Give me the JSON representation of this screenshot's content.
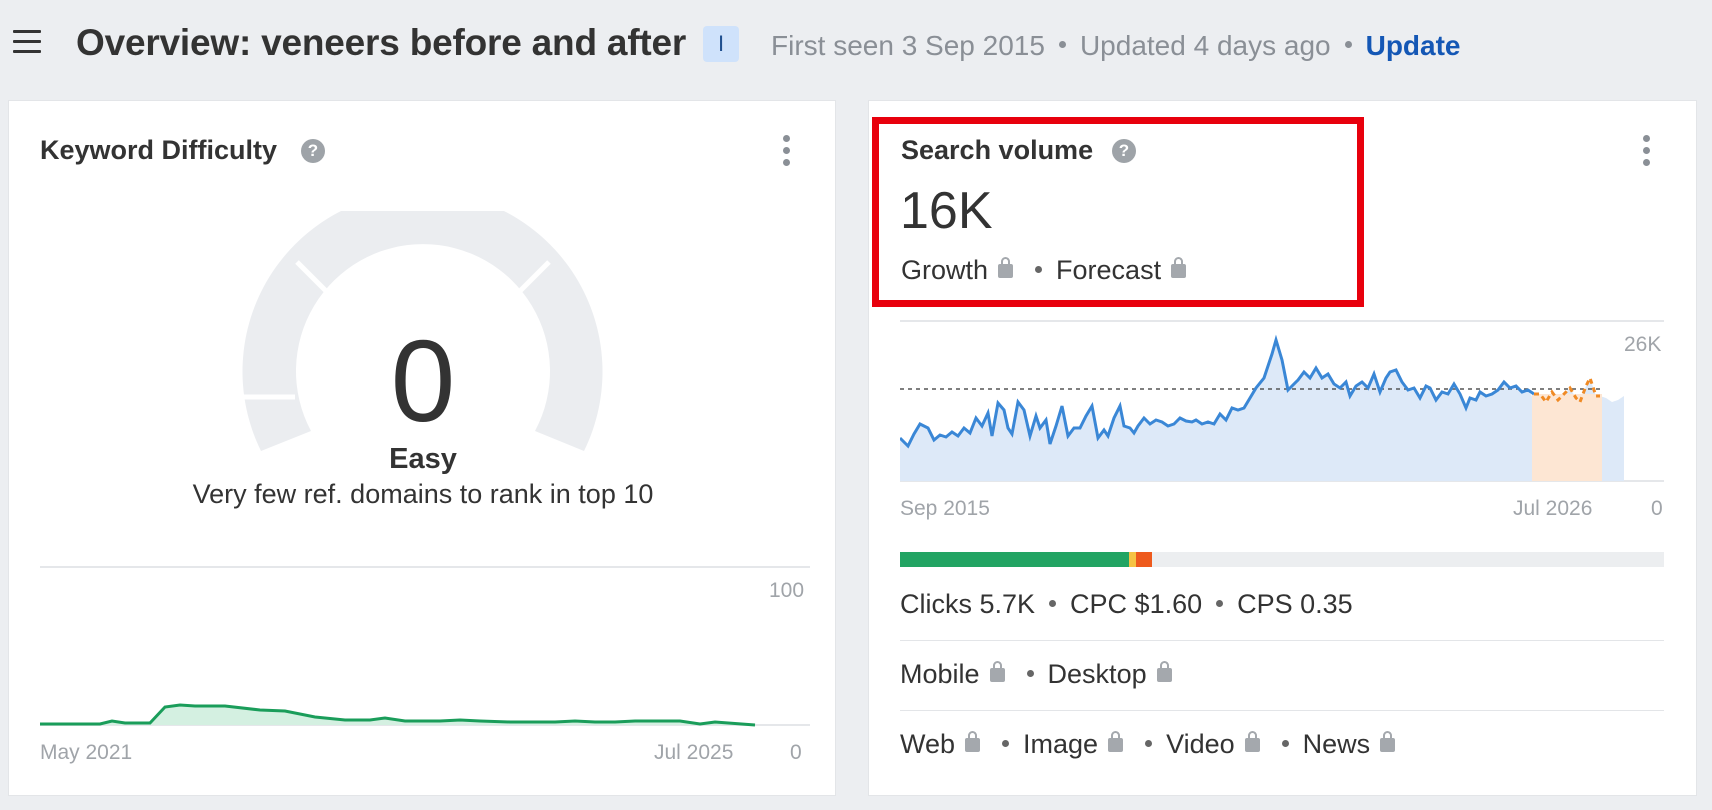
{
  "header": {
    "title": "Overview: veneers before and after",
    "badge": "I",
    "first_seen": "First seen 3 Sep 2015",
    "updated": "Updated 4 days ago",
    "update_link": "Update"
  },
  "kd": {
    "title": "Keyword Difficulty",
    "help": "?",
    "value": "0",
    "label": "Easy",
    "description": "Very few ref. domains to rank in top 10",
    "chart": {
      "y_max_label": "100",
      "y_min_label": "0",
      "x_start": "May 2021",
      "x_end": "Jul 2025"
    }
  },
  "sv": {
    "title": "Search volume",
    "help": "?",
    "value": "16K",
    "growth": "Growth",
    "forecast": "Forecast",
    "chart": {
      "y_max_label": "26K",
      "y_min_label": "0",
      "x_start": "Sep 2015",
      "x_end": "Jul 2026"
    },
    "metrics": {
      "clicks": "Clicks 5.7K",
      "cpc": "CPC $1.60",
      "cps": "CPS 0.35"
    },
    "devices": {
      "mobile": "Mobile",
      "desktop": "Desktop"
    },
    "sources": {
      "web": "Web",
      "image": "Image",
      "video": "Video",
      "news": "News"
    },
    "click_bar": [
      {
        "segment": "organic",
        "fraction": 0.3,
        "color": "#22a463"
      },
      {
        "segment": "paid-a",
        "fraction": 0.009,
        "color": "#f6c343"
      },
      {
        "segment": "paid-b",
        "fraction": 0.021,
        "color": "#ee5a1d"
      }
    ]
  },
  "colors": {
    "accent": "#1457b5",
    "highlight": "#e8000d",
    "kd_line": "#1a9d5a",
    "sv_line": "#3a87d6",
    "forecast": "#f08a24"
  }
}
